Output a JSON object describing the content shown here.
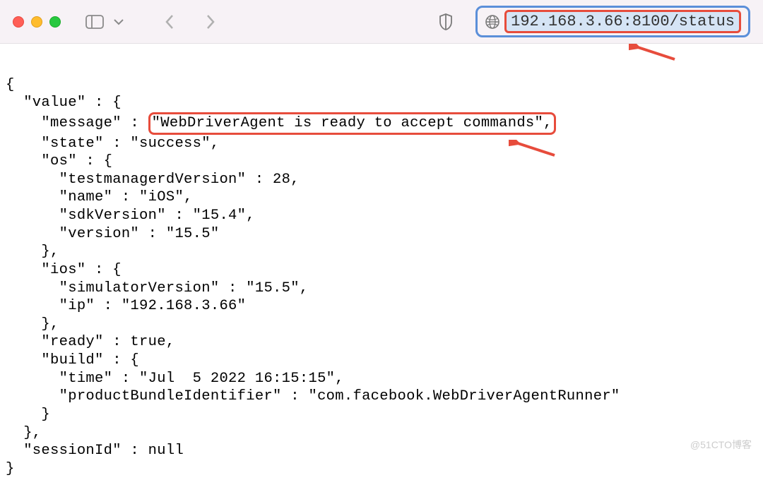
{
  "toolbar": {
    "url": "192.168.3.66:8100/status"
  },
  "json_response": {
    "value": {
      "message": "WebDriverAgent is ready to accept commands",
      "state": "success",
      "os": {
        "testmanagerdVersion": 28,
        "name": "iOS",
        "sdkVersion": "15.4",
        "version": "15.5"
      },
      "ios": {
        "simulatorVersion": "15.5",
        "ip": "192.168.3.66"
      },
      "ready": true,
      "build": {
        "time": "Jul  5 2022 16:15:15",
        "productBundleIdentifier": "com.facebook.WebDriverAgentRunner"
      }
    },
    "sessionId": null
  },
  "lines": {
    "l0": "{",
    "l1": "  \"value\" : {",
    "l2_pre": "    \"message\" : ",
    "l2_hl": "\"WebDriverAgent is ready to accept commands\",",
    "l3": "    \"state\" : \"success\",",
    "l4": "    \"os\" : {",
    "l5": "      \"testmanagerdVersion\" : 28,",
    "l6": "      \"name\" : \"iOS\",",
    "l7": "      \"sdkVersion\" : \"15.4\",",
    "l8": "      \"version\" : \"15.5\"",
    "l9": "    },",
    "l10": "    \"ios\" : {",
    "l11": "      \"simulatorVersion\" : \"15.5\",",
    "l12": "      \"ip\" : \"192.168.3.66\"",
    "l13": "    },",
    "l14": "    \"ready\" : true,",
    "l15": "    \"build\" : {",
    "l16": "      \"time\" : \"Jul  5 2022 16:15:15\",",
    "l17": "      \"productBundleIdentifier\" : \"com.facebook.WebDriverAgentRunner\"",
    "l18": "    }",
    "l19": "  },",
    "l20": "  \"sessionId\" : null",
    "l21": "}"
  },
  "watermark": "@51CTO博客"
}
